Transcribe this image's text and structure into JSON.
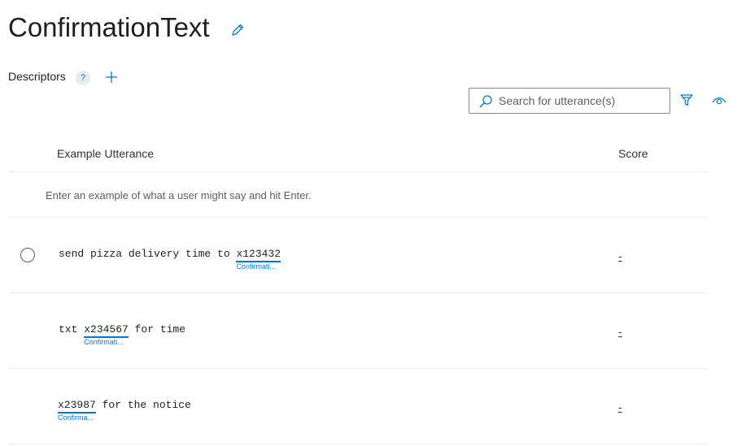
{
  "header": {
    "title": "ConfirmationText",
    "edit_icon": "pencil-icon"
  },
  "descriptors": {
    "label": "Descriptors",
    "help": "?",
    "add_icon": "plus-icon"
  },
  "search": {
    "placeholder": "Search for utterance(s)",
    "value": ""
  },
  "toolbar": {
    "filter_icon": "filter-icon",
    "view_icon": "eye-icon"
  },
  "table": {
    "columns": {
      "utterance": "Example Utterance",
      "score": "Score"
    },
    "entry_placeholder": "Enter an example of what a user might say and hit Enter.",
    "rows": [
      {
        "before": "send pizza delivery time to ",
        "entity": "x123432",
        "after": "",
        "entity_label": "Confirmati...",
        "score": "-"
      },
      {
        "before": "txt ",
        "entity": "x234567",
        "after": " for time",
        "entity_label": "Confirmati...",
        "score": "-"
      },
      {
        "before": "",
        "entity": "x23987",
        "after": " for the notice",
        "entity_label": "Confirma...",
        "score": "-"
      }
    ]
  },
  "colors": {
    "accent": "#0078d4",
    "divider": "#edebe9",
    "text": "#323130"
  }
}
